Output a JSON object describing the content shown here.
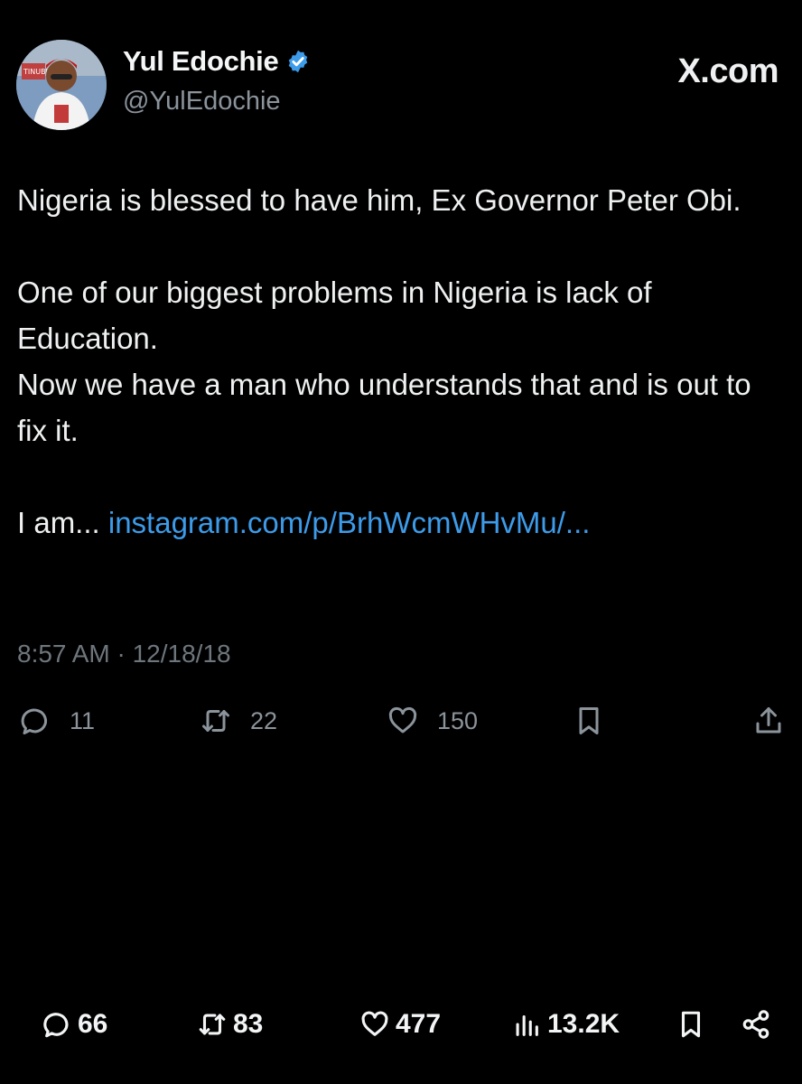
{
  "tweet": {
    "display_name": "Yul Edochie",
    "handle": "@YulEdochie",
    "brand": "X.com",
    "avatar_text": "TINUBU",
    "paragraph_1": "Nigeria is blessed to have him, Ex Governor Peter Obi.",
    "paragraph_2_line_1": "One of our biggest problems in Nigeria is lack of Education.",
    "paragraph_2_line_2": "Now we have a man who understands that and is out to fix it.",
    "paragraph_3_prefix": "I am... ",
    "link_text": "instagram.com/p/BrhWcmWHvMu/...",
    "timestamp": "8:57 AM · 12/18/18",
    "accent_color": "#3d9be9"
  },
  "tweet_actions": {
    "replies": "11",
    "reposts": "22",
    "likes": "150"
  },
  "bottom_bar": {
    "replies": "66",
    "reposts": "83",
    "likes": "477",
    "views": "13.2K"
  },
  "icons": [
    "verified-badge-icon",
    "reply-icon",
    "repost-icon",
    "like-icon",
    "bookmark-icon",
    "share-icon",
    "views-icon"
  ]
}
